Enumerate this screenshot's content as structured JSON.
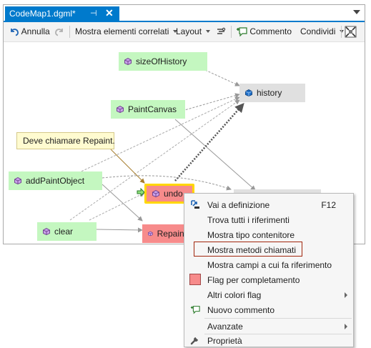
{
  "window": {
    "tab_title": "CodeMap1.dgml*",
    "pin_glyph": "⊣",
    "close_glyph": "✕"
  },
  "toolbar": {
    "undo_label": "Annulla",
    "related_label": "Mostra elementi correlati",
    "layout_label": "Layout",
    "comment_label": "Commento",
    "share_label": "Condividi"
  },
  "nodes": {
    "sizeOfHistory": "sizeOfHistory",
    "history": "history",
    "PaintCanvas": "PaintCanvas",
    "comment": "Deve chiamare Repaint.",
    "addPaintObject": "addPaintObject",
    "undo": "undo",
    "clear": "clear",
    "Repaint": "Repaint"
  },
  "menu": {
    "items": [
      {
        "label": "Vai a definizione",
        "key": "F12"
      },
      {
        "label": "Trova tutti i riferimenti"
      },
      {
        "label": "Mostra tipo contenitore"
      },
      {
        "label": "Mostra metodi chiamati"
      },
      {
        "label": "Mostra campi a cui fa riferimento"
      },
      {
        "label": "Flag per completamento"
      },
      {
        "label": "Altri colori flag"
      },
      {
        "label": "Nuovo commento"
      },
      {
        "label": "Avanzate"
      },
      {
        "label": "Proprietà"
      }
    ]
  },
  "colors": {
    "accent": "#007acc",
    "node_green": "#c4f7c0",
    "node_gray": "#e0e0e0",
    "node_red": "#f78b8b",
    "selection": "#ffd700",
    "highlight_border": "#a1260d",
    "comment_bg": "#fffbd0"
  }
}
